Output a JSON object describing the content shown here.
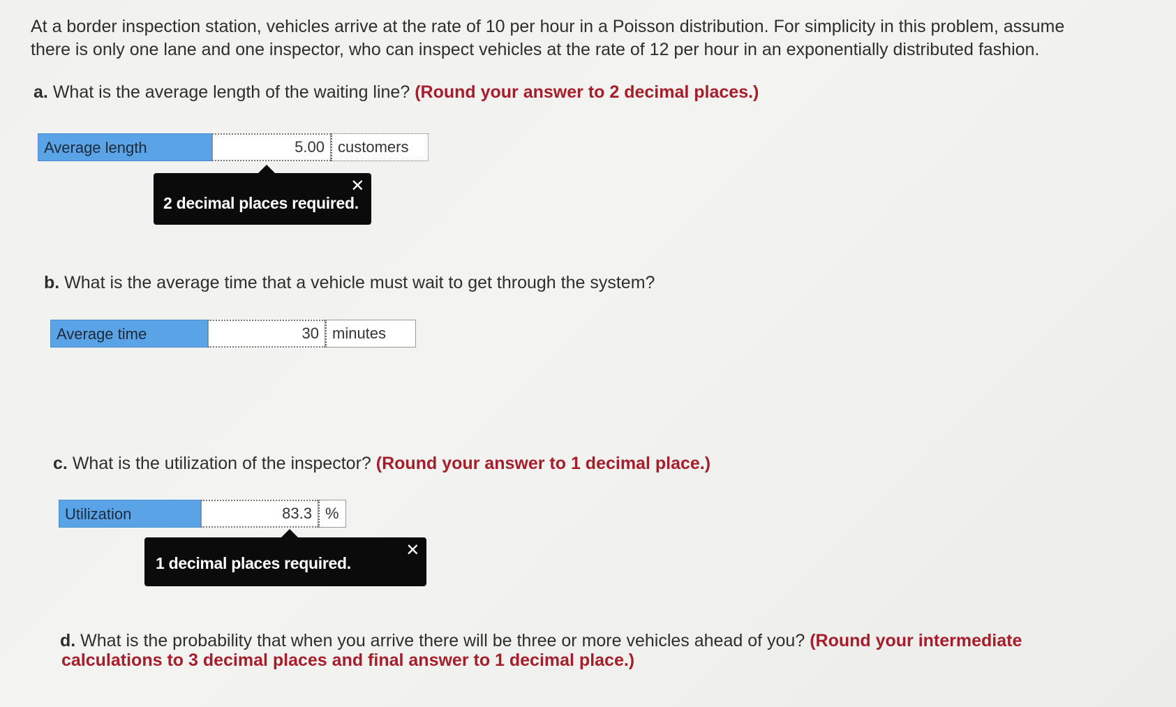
{
  "intro": {
    "line1": "At a border inspection station, vehicles arrive at the rate of 10 per hour in a Poisson distribution. For simplicity in this problem, assume",
    "line2": "there is only one lane and one inspector, who can inspect vehicles at the rate of 12 per hour in an exponentially distributed fashion."
  },
  "a": {
    "letter": "a.",
    "question": "What is the average length of the waiting line?",
    "instruction": "(Round your answer to 2 decimal places.)",
    "label": "Average length",
    "value": "5.00",
    "unit": "customers",
    "tooltip": "2 decimal places required.",
    "close": "✕"
  },
  "b": {
    "letter": "b.",
    "question": "What is the average time that a vehicle must wait to get through the system?",
    "label": "Average time",
    "value": "30",
    "unit": "minutes"
  },
  "c": {
    "letter": "c.",
    "question": "What is the utilization of the inspector?",
    "instruction": "(Round your answer to 1 decimal place.)",
    "label": "Utilization",
    "value": "83.3",
    "unit": "%",
    "tooltip": "1 decimal places required.",
    "close": "✕"
  },
  "d": {
    "letter": "d.",
    "question": "What is the probability that when you arrive there will be three or more vehicles ahead of you?",
    "instruction_line1": "(Round your intermediate",
    "instruction_line2": "calculations to 3 decimal places and final answer to 1 decimal place.)"
  }
}
